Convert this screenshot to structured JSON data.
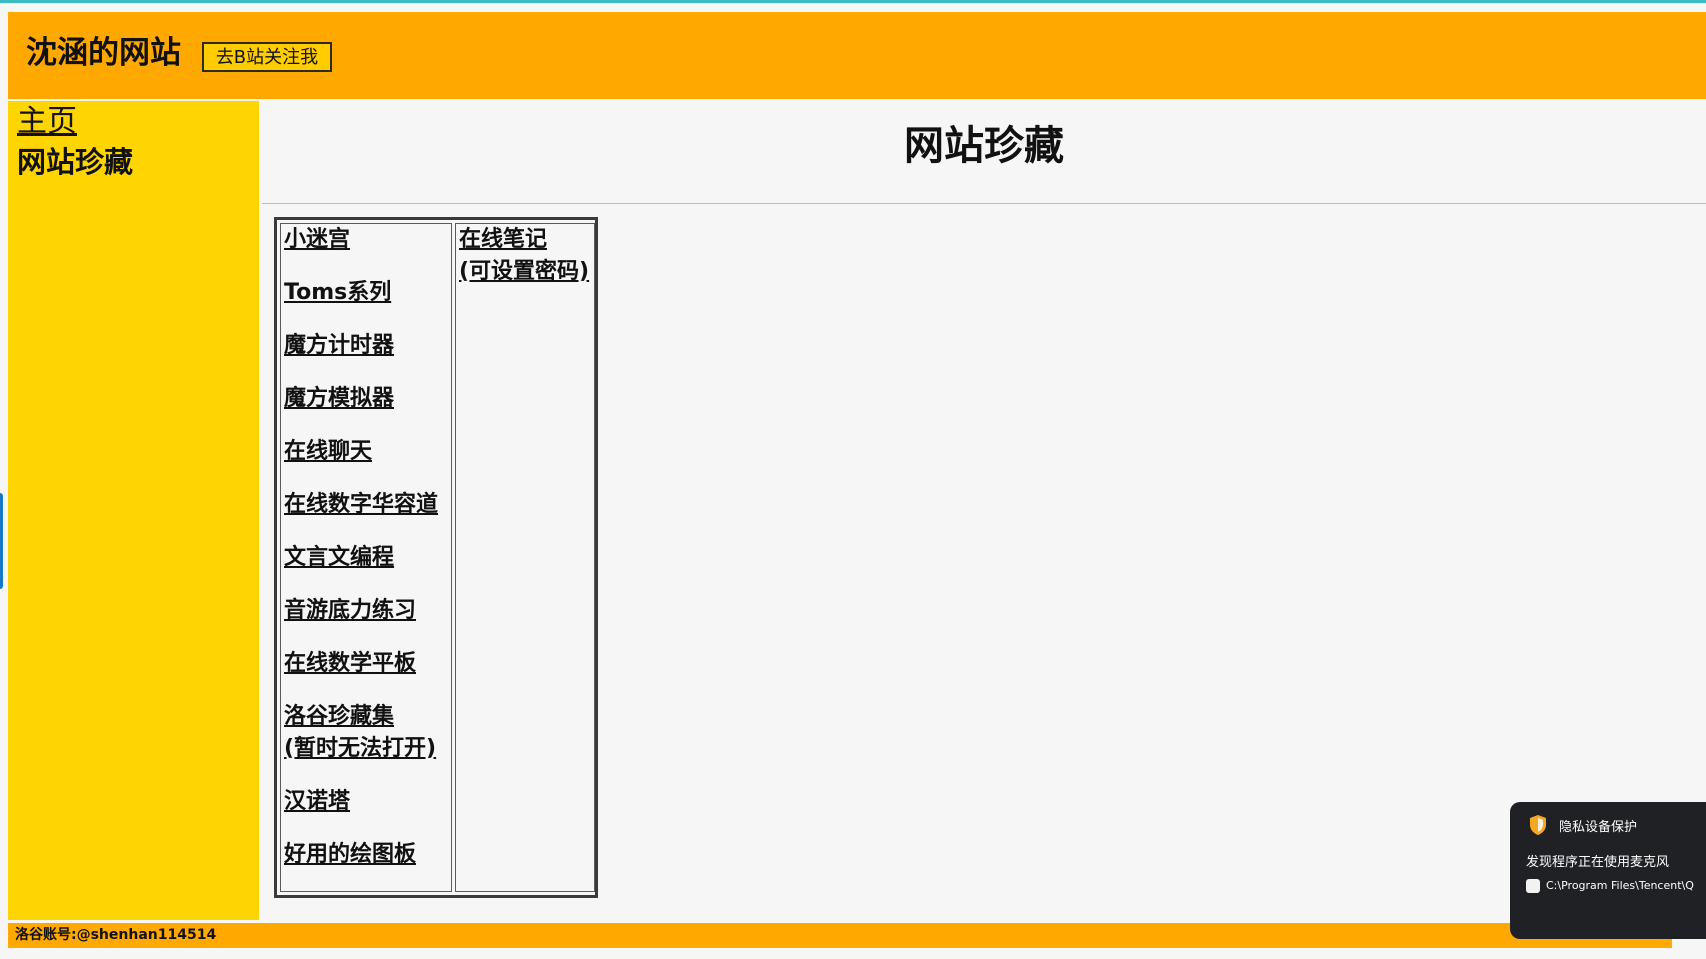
{
  "header": {
    "site_title": "沈涵的网站",
    "bili_button_label": "去B站关注我",
    "accent_color": "#ffa800"
  },
  "sidebar": {
    "home_label": "主页",
    "collection_label": "网站珍藏",
    "background_color": "#ffd500"
  },
  "main": {
    "page_title": "网站珍藏",
    "links_left": [
      "小迷宫",
      "Toms系列",
      "魔方计时器",
      "魔方模拟器",
      "在线聊天",
      "在线数字华容道",
      "文言文编程",
      "音游底力练习",
      "在线数学平板",
      "洛谷珍藏集\n(暂时无法打开)",
      "汉诺塔",
      "好用的绘图板"
    ],
    "links_right": [
      "在线笔记\n(可设置密码)"
    ]
  },
  "footer": {
    "text": "洛谷账号:@shenhan114514"
  },
  "toast": {
    "icon": "shield-icon",
    "title": "隐私设备保护",
    "message": "发现程序正在使用麦克风",
    "path": "C:\\Program Files\\Tencent\\Q"
  }
}
